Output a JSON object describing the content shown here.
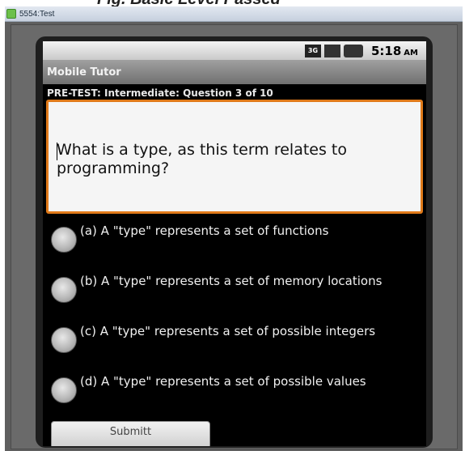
{
  "caption": "Fig. Basic Level Passed",
  "window": {
    "title": "5554:Test"
  },
  "status_bar": {
    "network_label": "3G",
    "time": "5:18",
    "ampm": "AM",
    "icons": [
      "3g-icon",
      "signal-icon",
      "battery-icon"
    ]
  },
  "app": {
    "title": "Mobile Tutor"
  },
  "quiz": {
    "header": "PRE-TEST: Intermediate:  Question 3 of 10",
    "question": "What is a type, as this term relates to programming?",
    "options": [
      {
        "label": "(a) A \"type\" represents a set of functions"
      },
      {
        "label": "(b) A \"type\" represents a set of memory locations"
      },
      {
        "label": "(c) A \"type\" represents a set of possible integers"
      },
      {
        "label": "(d) A \"type\" represents a set of possible values"
      }
    ],
    "submit_label": "Submitt"
  },
  "colors": {
    "accent_border": "#e07a1a",
    "screen_bg": "#000000",
    "titlebar_bg": "#808080"
  }
}
